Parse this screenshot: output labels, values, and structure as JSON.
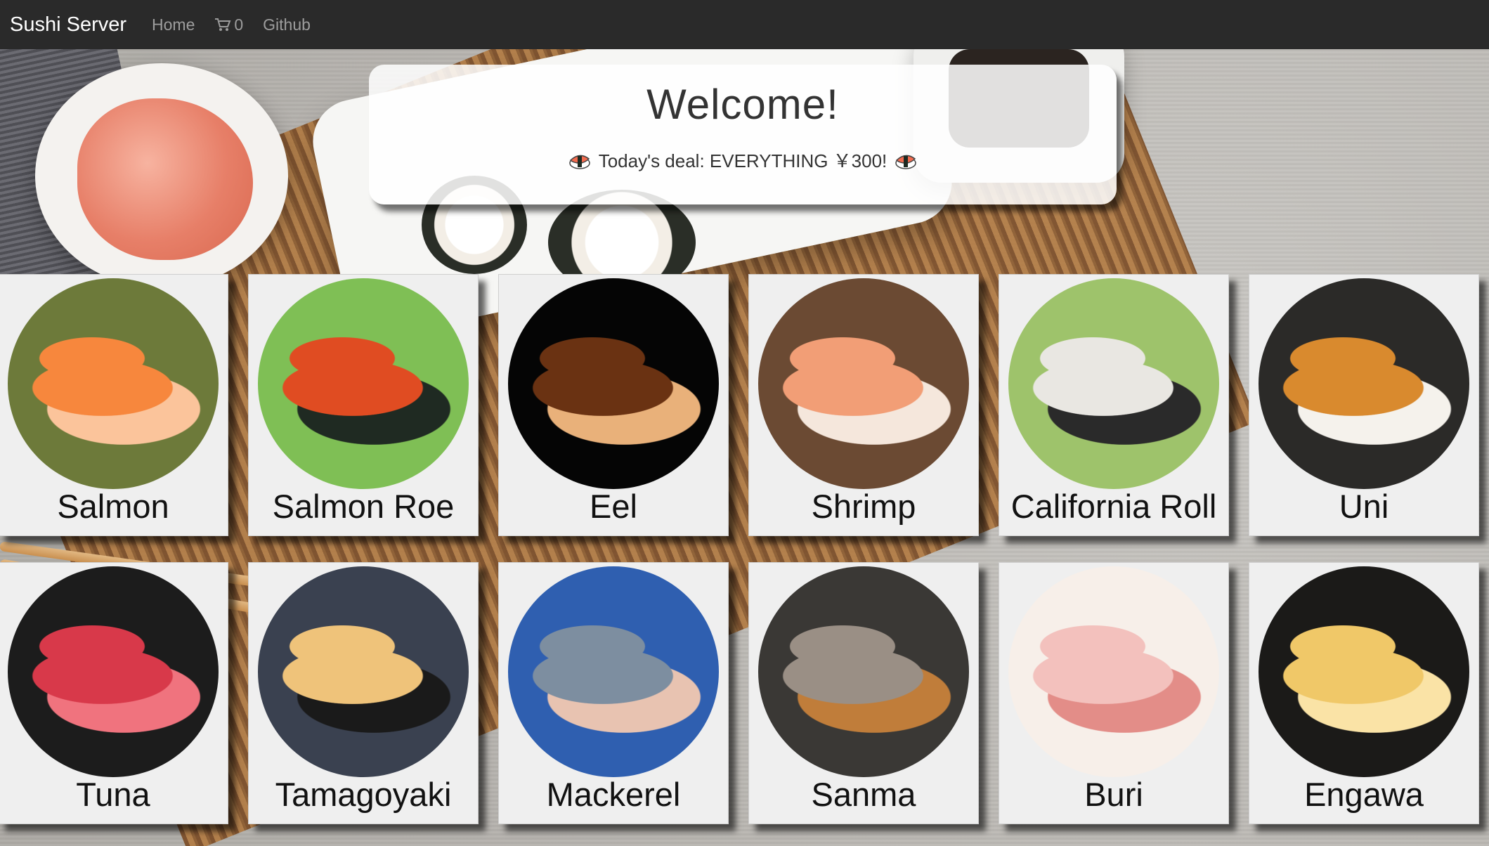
{
  "navbar": {
    "brand": "Sushi Server",
    "home": "Home",
    "cart_count": "0",
    "github": "Github",
    "cart_icon": "cart-icon"
  },
  "welcome": {
    "title": "Welcome!",
    "deal": "Today's deal: EVERYTHING ￥300!",
    "deal_icon": "sushi-icon"
  },
  "menu": [
    {
      "name": "Salmon",
      "colors": [
        "#f7873d",
        "#fbc49b",
        "#6d7a3a"
      ],
      "icon": "salmon-nigiri-photo"
    },
    {
      "name": "Salmon Roe",
      "colors": [
        "#e04c22",
        "#1f2a22",
        "#7fbf55"
      ],
      "icon": "salmon-roe-photo"
    },
    {
      "name": "Eel",
      "colors": [
        "#6a3212",
        "#e9b17a",
        "#050505"
      ],
      "icon": "eel-nigiri-photo"
    },
    {
      "name": "Shrimp",
      "colors": [
        "#f29e76",
        "#f5e7dc",
        "#6b4a33"
      ],
      "icon": "shrimp-nigiri-photo"
    },
    {
      "name": "California Roll",
      "colors": [
        "#e9e7e2",
        "#2a2a2a",
        "#9ec36b"
      ],
      "icon": "california-roll-photo"
    },
    {
      "name": "Uni",
      "colors": [
        "#d98a2e",
        "#f5f2ec",
        "#2b2a28"
      ],
      "icon": "uni-nigiri-photo"
    },
    {
      "name": "Tuna",
      "colors": [
        "#d8394a",
        "#f0737e",
        "#1c1c1c"
      ],
      "icon": "tuna-nigiri-photo"
    },
    {
      "name": "Tamagoyaki",
      "colors": [
        "#efc37a",
        "#1a1a1a",
        "#3a4150"
      ],
      "icon": "tamagoyaki-photo"
    },
    {
      "name": "Mackerel",
      "colors": [
        "#7d8ea0",
        "#e8c3b1",
        "#2f5fb0"
      ],
      "icon": "mackerel-nigiri-photo"
    },
    {
      "name": "Sanma",
      "colors": [
        "#9a8f85",
        "#c07d3a",
        "#3a3835"
      ],
      "icon": "sanma-nigiri-photo"
    },
    {
      "name": "Buri",
      "colors": [
        "#f3c1bd",
        "#e38d88",
        "#f7efe9"
      ],
      "icon": "buri-nigiri-photo"
    },
    {
      "name": "Engawa",
      "colors": [
        "#f0c868",
        "#fae3a6",
        "#1b1a18"
      ],
      "icon": "engawa-nigiri-photo"
    }
  ]
}
